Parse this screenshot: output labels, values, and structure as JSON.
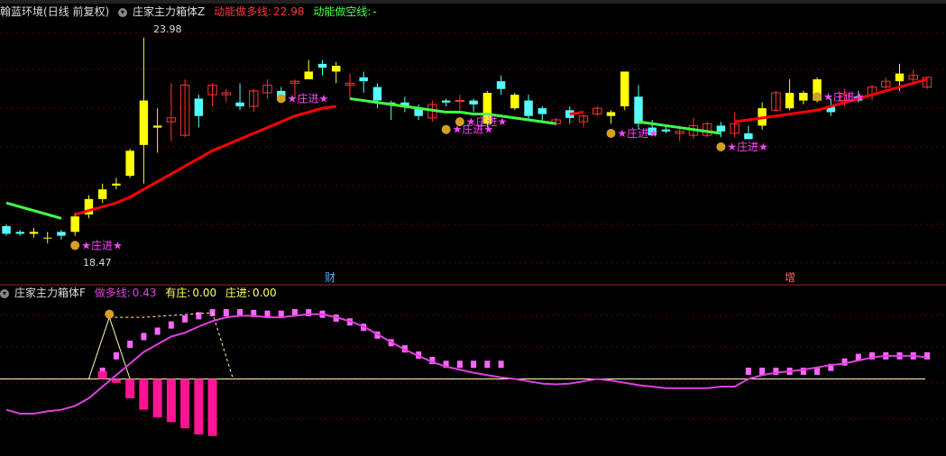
{
  "top_panel": {
    "stock_name": "翰蓝环境",
    "period": "(日线 前复权)",
    "indicator_name": "庄家主力箱体Z",
    "long_label": "动能做多线:",
    "long_value": "22.98",
    "short_label": "动能做空线:",
    "short_value": "-"
  },
  "bottom_panel": {
    "indicator_name": "庄家主力箱体F",
    "long_label": "做多线:",
    "long_value": "0.43",
    "has_label": "有庄:",
    "has_value": "0.00",
    "enter_label": "庄进:",
    "enter_value": "0.00"
  },
  "price_annotations": {
    "high": "23.98",
    "low": "18.47"
  },
  "markers": {
    "finance": "财",
    "increase": "增",
    "signal": "★庄进★"
  },
  "colors": {
    "up_candle": "#ffff00",
    "up_hollow": "#ff3333",
    "down_candle": "#54ffff",
    "long_line": "#ff0000",
    "short_line": "#44ff44",
    "osc_line": "#e040e0",
    "bar_pos": "#ff66ff",
    "bar_neg": "#ff1493",
    "zero_line": "#ffffb0"
  },
  "chart_data": [
    {
      "type": "candlestick",
      "title": "庄家主力箱体Z",
      "ylim": [
        18.0,
        24.3
      ],
      "x": [
        1,
        2,
        3,
        4,
        5,
        6,
        7,
        8,
        9,
        10,
        11,
        12,
        13,
        14,
        15,
        16,
        17,
        18,
        19,
        20,
        21,
        22,
        23,
        24,
        25,
        26,
        27,
        28,
        29,
        30,
        31,
        32,
        33,
        34,
        35,
        36,
        37,
        38,
        39,
        40,
        41,
        42,
        43,
        44,
        45,
        46,
        47,
        48,
        49,
        50,
        51,
        52,
        53,
        54,
        55,
        56,
        57,
        58,
        59,
        60,
        61,
        62,
        63,
        64,
        65,
        66,
        67,
        68
      ],
      "candles": [
        [
          19.1,
          18.9,
          19.15,
          18.85,
          "down"
        ],
        [
          18.95,
          18.9,
          19.0,
          18.85,
          "down"
        ],
        [
          18.9,
          18.95,
          19.05,
          18.8,
          "up"
        ],
        [
          18.8,
          18.8,
          18.95,
          18.65,
          "up"
        ],
        [
          18.95,
          18.85,
          19.0,
          18.75,
          "down"
        ],
        [
          18.95,
          19.35,
          19.45,
          18.85,
          "up"
        ],
        [
          19.4,
          19.8,
          19.9,
          19.3,
          "up"
        ],
        [
          19.8,
          20.05,
          20.2,
          19.7,
          "up"
        ],
        [
          20.15,
          20.2,
          20.35,
          20.05,
          "up"
        ],
        [
          20.4,
          21.05,
          21.1,
          20.35,
          "up"
        ],
        [
          21.2,
          22.35,
          23.98,
          20.2,
          "up"
        ],
        [
          21.65,
          21.7,
          22.15,
          21.0,
          "up"
        ],
        [
          21.8,
          21.9,
          22.8,
          21.3,
          "hollow"
        ],
        [
          21.45,
          22.75,
          22.9,
          21.4,
          "hollow"
        ],
        [
          22.4,
          21.95,
          22.5,
          21.65,
          "down"
        ],
        [
          22.5,
          22.75,
          22.8,
          22.2,
          "hollow"
        ],
        [
          22.5,
          22.55,
          22.65,
          22.3,
          "hollow"
        ],
        [
          22.3,
          22.2,
          22.8,
          22.1,
          "down"
        ],
        [
          22.2,
          22.6,
          22.65,
          22.05,
          "hollow"
        ],
        [
          22.55,
          22.75,
          22.9,
          22.4,
          "hollow"
        ],
        [
          22.6,
          22.35,
          22.7,
          22.3,
          "down"
        ],
        [
          22.8,
          22.85,
          22.9,
          22.4,
          "hollow"
        ],
        [
          22.9,
          23.1,
          23.4,
          22.9,
          "up"
        ],
        [
          23.3,
          23.2,
          23.4,
          23.0,
          "down"
        ],
        [
          23.1,
          23.25,
          23.35,
          22.8,
          "up"
        ],
        [
          22.8,
          22.75,
          23.05,
          22.4,
          "hollow"
        ],
        [
          22.95,
          22.85,
          23.1,
          22.55,
          "down"
        ],
        [
          22.7,
          22.35,
          22.8,
          22.15,
          "down"
        ],
        [
          22.3,
          22.25,
          22.35,
          21.85,
          "down"
        ],
        [
          22.3,
          22.2,
          22.45,
          22.05,
          "down"
        ],
        [
          22.15,
          21.95,
          22.25,
          21.85,
          "down"
        ],
        [
          21.9,
          22.25,
          22.35,
          21.8,
          "hollow"
        ],
        [
          22.35,
          22.3,
          22.4,
          22.2,
          "down"
        ],
        [
          22.35,
          22.35,
          22.5,
          22.1,
          "hollow"
        ],
        [
          22.35,
          22.25,
          22.4,
          22.05,
          "down"
        ],
        [
          21.75,
          22.55,
          22.6,
          21.65,
          "up"
        ],
        [
          22.85,
          22.65,
          23.0,
          22.5,
          "down"
        ],
        [
          22.15,
          22.5,
          22.55,
          22.1,
          "up"
        ],
        [
          22.35,
          21.95,
          22.5,
          21.85,
          "down"
        ],
        [
          22.15,
          22.0,
          22.2,
          21.8,
          "down"
        ],
        [
          21.75,
          21.85,
          21.9,
          21.7,
          "hollow"
        ],
        [
          22.1,
          21.9,
          22.2,
          21.75,
          "down"
        ],
        [
          21.95,
          21.8,
          22.0,
          21.65,
          "hollow"
        ],
        [
          22.0,
          22.15,
          22.2,
          21.95,
          "hollow"
        ],
        [
          21.95,
          22.05,
          22.1,
          21.75,
          "up"
        ],
        [
          22.2,
          23.1,
          23.1,
          22.1,
          "up"
        ],
        [
          22.45,
          21.75,
          22.75,
          21.6,
          "down"
        ],
        [
          21.65,
          21.45,
          21.85,
          21.45,
          "down"
        ],
        [
          21.6,
          21.55,
          21.7,
          21.5,
          "down"
        ],
        [
          21.5,
          21.55,
          21.7,
          21.3,
          "hollow"
        ],
        [
          21.45,
          21.7,
          21.9,
          21.35,
          "hollow"
        ],
        [
          21.45,
          21.75,
          21.8,
          21.4,
          "hollow"
        ],
        [
          21.7,
          21.55,
          21.8,
          21.4,
          "down"
        ],
        [
          21.5,
          21.75,
          22.05,
          21.4,
          "hollow"
        ],
        [
          21.5,
          21.35,
          21.7,
          21.35,
          "down"
        ],
        [
          21.7,
          22.15,
          22.3,
          21.6,
          "up"
        ],
        [
          22.1,
          22.55,
          22.6,
          22.05,
          "hollow"
        ],
        [
          22.15,
          22.55,
          22.9,
          22.1,
          "up"
        ],
        [
          22.35,
          22.55,
          22.6,
          22.25,
          "up"
        ],
        [
          22.35,
          22.9,
          22.95,
          22.3,
          "up"
        ],
        [
          22.2,
          22.05,
          22.4,
          21.95,
          "down"
        ],
        [
          22.35,
          22.5,
          22.65,
          22.2,
          "hollow"
        ],
        [
          22.35,
          22.45,
          22.6,
          22.3,
          "down"
        ],
        [
          22.7,
          22.5,
          22.75,
          22.35,
          "hollow"
        ],
        [
          22.7,
          22.85,
          22.95,
          22.65,
          "hollow"
        ],
        [
          22.85,
          23.05,
          23.3,
          22.6,
          "up"
        ],
        [
          22.9,
          23.0,
          23.15,
          22.75,
          "hollow"
        ],
        [
          22.7,
          22.95,
          22.95,
          22.65,
          "hollow"
        ]
      ],
      "long_line": [
        null,
        null,
        null,
        null,
        null,
        19.4,
        19.5,
        19.6,
        19.7,
        19.85,
        20.05,
        20.25,
        20.45,
        20.65,
        20.85,
        21.05,
        21.2,
        21.35,
        21.5,
        21.65,
        21.8,
        21.95,
        22.05,
        22.15,
        22.2,
        null,
        null,
        null,
        null,
        null,
        null,
        null,
        null,
        null,
        null,
        null,
        null,
        null,
        null,
        null,
        null,
        22.0,
        22.05,
        null,
        null,
        null,
        null,
        null,
        null,
        null,
        null,
        null,
        null,
        21.8,
        21.85,
        21.9,
        21.95,
        22.0,
        22.05,
        22.1,
        22.2,
        22.3,
        22.4,
        22.5,
        22.6,
        22.7,
        22.8,
        22.9
      ],
      "short_line": [
        19.7,
        19.6,
        19.5,
        19.4,
        19.3,
        null,
        null,
        null,
        null,
        null,
        null,
        null,
        null,
        null,
        null,
        null,
        null,
        null,
        null,
        null,
        null,
        null,
        null,
        null,
        null,
        22.4,
        22.35,
        22.3,
        22.25,
        22.2,
        22.15,
        22.1,
        22.05,
        22.05,
        22.0,
        22.0,
        21.95,
        21.9,
        21.85,
        21.8,
        21.75,
        null,
        null,
        null,
        null,
        null,
        21.8,
        21.75,
        21.7,
        21.65,
        21.6,
        21.55,
        21.5,
        null,
        null,
        null,
        null,
        null,
        null,
        null,
        null,
        null,
        null,
        null,
        null,
        null,
        null,
        null
      ]
    },
    {
      "type": "bar",
      "title": "庄家主力箱体F",
      "ylim": [
        -1.0,
        1.0
      ],
      "line_values": [
        -0.4,
        -0.45,
        -0.45,
        -0.42,
        -0.4,
        -0.35,
        -0.25,
        -0.1,
        0.05,
        0.2,
        0.35,
        0.45,
        0.55,
        0.6,
        0.68,
        0.75,
        0.8,
        0.82,
        0.82,
        0.8,
        0.8,
        0.82,
        0.84,
        0.84,
        0.8,
        0.75,
        0.68,
        0.58,
        0.48,
        0.38,
        0.3,
        0.22,
        0.16,
        0.12,
        0.08,
        0.05,
        0.02,
        0.0,
        -0.03,
        -0.06,
        -0.07,
        -0.06,
        -0.03,
        0.0,
        -0.02,
        -0.05,
        -0.08,
        -0.1,
        -0.12,
        -0.12,
        -0.12,
        -0.12,
        -0.1,
        -0.1,
        0.0,
        0.05,
        0.08,
        0.1,
        0.12,
        0.15,
        0.18,
        0.2,
        0.24,
        0.28,
        0.3,
        0.3,
        0.3,
        0.28
      ],
      "pos_bars": [
        null,
        null,
        null,
        null,
        null,
        null,
        null,
        0.1,
        0.3,
        0.45,
        0.55,
        0.62,
        0.7,
        0.78,
        0.82,
        0.86,
        0.86,
        0.86,
        0.85,
        0.84,
        0.84,
        0.86,
        0.86,
        0.84,
        0.79,
        0.74,
        0.67,
        0.57,
        0.47,
        0.39,
        0.31,
        0.24,
        0.19,
        0.19,
        0.19,
        0.19,
        0.19,
        null,
        null,
        null,
        null,
        null,
        null,
        null,
        null,
        null,
        null,
        null,
        null,
        null,
        null,
        null,
        null,
        null,
        0.1,
        0.1,
        0.1,
        0.1,
        0.1,
        0.1,
        0.15,
        0.22,
        0.28,
        0.3,
        0.3,
        0.3,
        0.3,
        0.3
      ],
      "neg_bars": [
        null,
        null,
        null,
        null,
        null,
        null,
        null,
        null,
        -0.05,
        -0.25,
        -0.4,
        -0.5,
        -0.56,
        -0.64,
        -0.72,
        -0.74,
        null,
        null,
        null,
        null,
        null,
        null,
        null,
        null,
        null,
        null,
        null,
        null,
        null,
        null,
        null,
        null,
        null,
        null,
        null,
        null,
        null,
        null,
        null,
        null,
        null,
        null,
        null,
        null,
        null,
        null,
        null,
        null,
        null,
        null,
        null,
        null,
        null,
        null,
        null,
        null,
        null,
        null,
        null,
        null,
        null,
        null,
        null,
        null,
        null,
        null,
        null,
        null
      ]
    }
  ]
}
